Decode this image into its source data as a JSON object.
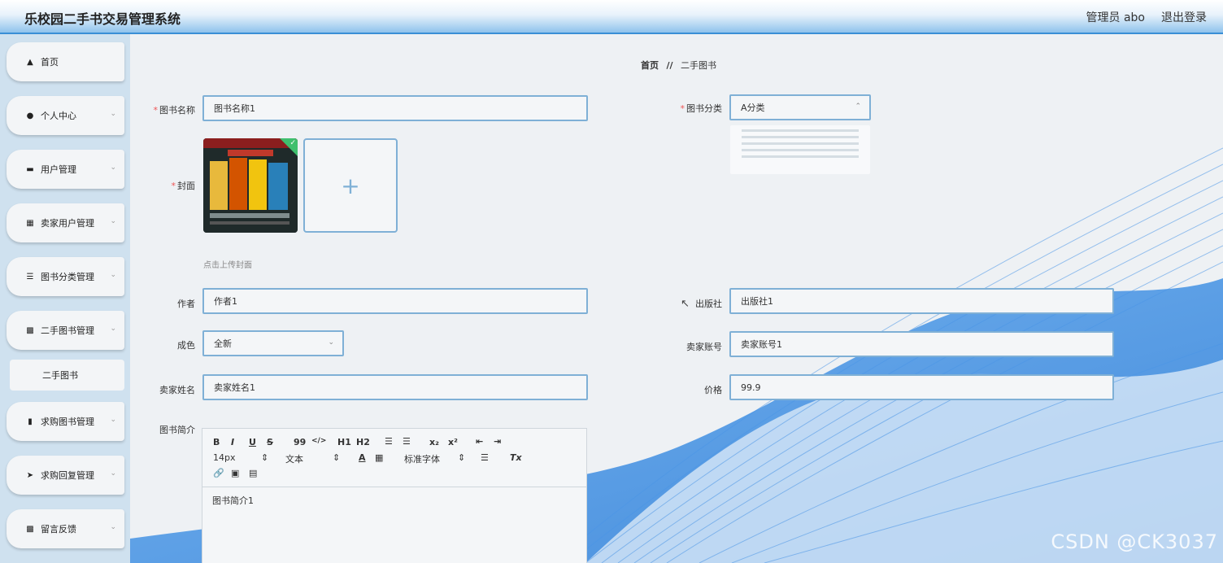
{
  "header": {
    "title": "乐校园二手书交易管理系统",
    "admin_label": "管理员 abo",
    "logout_label": "退出登录"
  },
  "sidebar": {
    "items": [
      {
        "label": "首页",
        "icon": "home-icon"
      },
      {
        "label": "个人中心",
        "icon": "user-icon"
      },
      {
        "label": "用户管理",
        "icon": "monitor-icon"
      },
      {
        "label": "卖家用户管理",
        "icon": "chart-icon"
      },
      {
        "label": "图书分类管理",
        "icon": "list-icon"
      },
      {
        "label": "二手图书管理",
        "icon": "grid-icon"
      },
      {
        "label": "求购图书管理",
        "icon": "book-icon"
      },
      {
        "label": "求购回复管理",
        "icon": "send-icon"
      },
      {
        "label": "留言反馈",
        "icon": "grid-icon"
      }
    ],
    "submenu": {
      "label": "二手图书"
    }
  },
  "breadcrumb": {
    "home": "首页",
    "separator": "//",
    "current": "二手图书"
  },
  "form": {
    "book_name": {
      "label": "图书名称",
      "value": "图书名称1"
    },
    "category": {
      "label": "图书分类",
      "value": "A分类"
    },
    "cover": {
      "label": "封面",
      "hint": "点击上传封面",
      "add_glyph": "+"
    },
    "author": {
      "label": "作者",
      "value": "作者1"
    },
    "publisher": {
      "label": "出版社",
      "value": "出版社1"
    },
    "condition": {
      "label": "成色",
      "value": "全新"
    },
    "seller_account": {
      "label": "卖家账号",
      "value": "卖家账号1"
    },
    "seller_name": {
      "label": "卖家姓名",
      "value": "卖家姓名1"
    },
    "price": {
      "label": "价格",
      "value": "99.9"
    },
    "intro": {
      "label": "图书简介",
      "value": "图书简介1"
    }
  },
  "editor_toolbar": {
    "bold": "B",
    "italic": "I",
    "underline": "U",
    "strike": "S",
    "quote": "99",
    "code": "</>",
    "h1": "H1",
    "h2": "H2",
    "subscript": "x₂",
    "superscript": "x²",
    "font_size": "14px",
    "text_style": "文本",
    "font_family": "标准字体",
    "clear": "Tx"
  },
  "colors": {
    "accent": "#3a8fd6",
    "input_border": "#7fb0d6",
    "required": "#e55555"
  },
  "watermark": "CSDN @CK3037"
}
